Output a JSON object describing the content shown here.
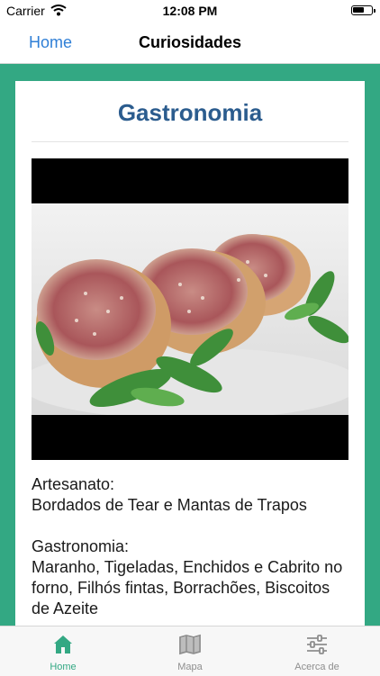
{
  "status_bar": {
    "carrier": "Carrier",
    "time": "12:08 PM"
  },
  "nav": {
    "back_label": "Home",
    "title": "Curiosidades"
  },
  "card": {
    "title": "Gastronomia",
    "artesanato_heading": "Artesanato:",
    "artesanato_text": "Bordados de Tear e Mantas de Trapos",
    "gastronomia_heading": "Gastronomia:",
    "gastronomia_text": "Maranho, Tigeladas, Enchidos e Cabrito no forno, Filhós fintas, Borrachões, Biscoitos de Azeite"
  },
  "tabs": [
    {
      "label": "Home",
      "icon": "home-icon",
      "active": true
    },
    {
      "label": "Mapa",
      "icon": "map-icon",
      "active": false
    },
    {
      "label": "Acerca de",
      "icon": "sliders-icon",
      "active": false
    }
  ],
  "colors": {
    "accent": "#33a883",
    "title": "#2b5c8e",
    "link": "#2f7fd6"
  }
}
